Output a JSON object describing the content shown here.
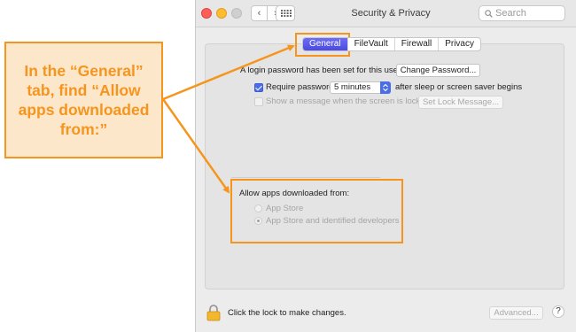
{
  "window": {
    "title": "Security & Privacy",
    "nav_back": "‹",
    "nav_forward": "›",
    "search_placeholder": "Search"
  },
  "tabs": [
    "General",
    "FileVault",
    "Firewall",
    "Privacy"
  ],
  "general": {
    "login_password_text": "A login password has been set for this user",
    "change_password_button": "Change Password...",
    "require_password_label": "Require password",
    "require_password_checked": true,
    "require_password_value": "5 minutes",
    "after_sleep_text": "after sleep or screen saver begins",
    "show_message_label": "Show a message when the screen is locked",
    "show_message_checked": false,
    "set_lock_message_button": "Set Lock Message...",
    "allow_apps_heading": "Allow apps downloaded from:",
    "allow_options": [
      "App Store",
      "App Store and identified developers"
    ],
    "allow_selected": "App Store and identified developers"
  },
  "footer": {
    "lock_text": "Click the lock to make changes.",
    "advanced_button": "Advanced...",
    "help_button": "?"
  },
  "annotation": {
    "callout_text": "In the “General” tab, find “Allow apps downloaded from:”",
    "color": "#f6951d",
    "fill": "#fde7cb"
  }
}
